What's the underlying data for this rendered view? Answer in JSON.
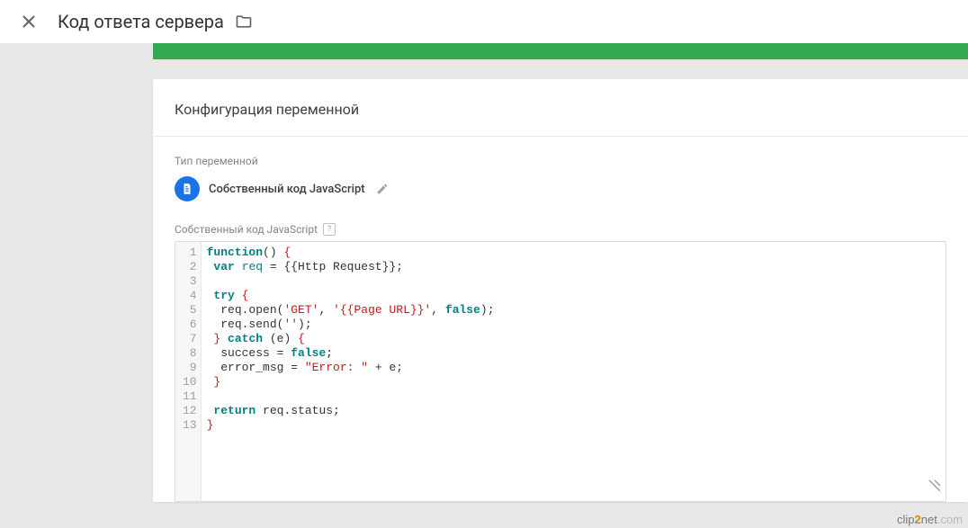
{
  "header": {
    "title": "Код ответа сервера"
  },
  "card": {
    "title": "Конфигурация переменной"
  },
  "varType": {
    "section_label": "Тип переменной",
    "name": "Собственный код JavaScript"
  },
  "editor": {
    "label": "Собственный код JavaScript",
    "lines": [
      {
        "n": 1,
        "tokens": [
          [
            "function",
            "kw"
          ],
          [
            "() ",
            ""
          ],
          [
            "{",
            "brace"
          ]
        ]
      },
      {
        "n": 2,
        "tokens": [
          [
            " ",
            ""
          ],
          [
            "var",
            "kw"
          ],
          [
            " ",
            ""
          ],
          [
            "req",
            "var"
          ],
          [
            " = {{Http Request}};",
            ""
          ]
        ]
      },
      {
        "n": 3,
        "tokens": [
          [
            "",
            ""
          ]
        ]
      },
      {
        "n": 4,
        "tokens": [
          [
            " ",
            ""
          ],
          [
            "try",
            "kw"
          ],
          [
            " ",
            ""
          ],
          [
            "{",
            "brace"
          ]
        ]
      },
      {
        "n": 5,
        "tokens": [
          [
            "  req.open(",
            ""
          ],
          [
            "'GET'",
            "str"
          ],
          [
            ", ",
            ""
          ],
          [
            "'{{Page URL}}'",
            "str"
          ],
          [
            ", ",
            ""
          ],
          [
            "false",
            "kw"
          ],
          [
            ");",
            ""
          ]
        ]
      },
      {
        "n": 6,
        "tokens": [
          [
            "  req.send(",
            ""
          ],
          [
            "''",
            "str"
          ],
          [
            ");",
            ""
          ]
        ]
      },
      {
        "n": 7,
        "tokens": [
          [
            " ",
            ""
          ],
          [
            "}",
            "brace"
          ],
          [
            " ",
            ""
          ],
          [
            "catch",
            "kw"
          ],
          [
            " (e) ",
            ""
          ],
          [
            "{",
            "brace"
          ]
        ]
      },
      {
        "n": 8,
        "tokens": [
          [
            "  success = ",
            ""
          ],
          [
            "false",
            "kw"
          ],
          [
            ";",
            ""
          ]
        ]
      },
      {
        "n": 9,
        "tokens": [
          [
            "  error_msg = ",
            ""
          ],
          [
            "\"Error: \"",
            "str"
          ],
          [
            " + e;",
            ""
          ]
        ]
      },
      {
        "n": 10,
        "tokens": [
          [
            " ",
            ""
          ],
          [
            "}",
            "brace"
          ]
        ]
      },
      {
        "n": 11,
        "tokens": [
          [
            "",
            ""
          ]
        ]
      },
      {
        "n": 12,
        "tokens": [
          [
            " ",
            ""
          ],
          [
            "return",
            "kw"
          ],
          [
            " req.status;",
            ""
          ]
        ]
      },
      {
        "n": 13,
        "tokens": [
          [
            "}",
            "brace"
          ]
        ]
      }
    ]
  },
  "watermark": {
    "part1": "clip",
    "part2": "2",
    "part3": "net",
    "part4": ".com"
  }
}
